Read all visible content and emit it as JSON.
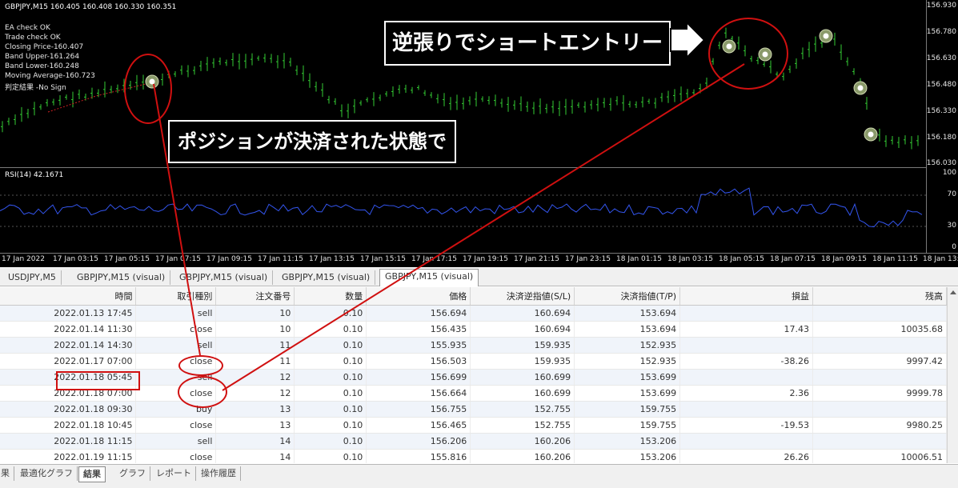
{
  "chart": {
    "header": "GBPJPY,M15  160.405 160.408 160.330 160.351",
    "info_lines": [
      "EA check OK",
      "Trade check OK",
      "Closing Price-160.407",
      "Band Upper-161.264",
      "Band Lower-160.248",
      "Moving Average-160.723",
      "判定結果 -No Sign"
    ],
    "price_labels": [
      "156.930",
      "156.780",
      "156.630",
      "156.480",
      "156.330",
      "156.180",
      "156.030"
    ],
    "rsi_label": "RSI(14) 42.1671",
    "rsi_levels": [
      "100",
      "70",
      "30",
      "0"
    ],
    "time_labels": [
      "17 Jan 2022",
      "17 Jan 03:15",
      "17 Jan 05:15",
      "17 Jan 07:15",
      "17 Jan 09:15",
      "17 Jan 11:15",
      "17 Jan 13:15",
      "17 Jan 15:15",
      "17 Jan 17:15",
      "17 Jan 19:15",
      "17 Jan 21:15",
      "17 Jan 23:15",
      "18 Jan 01:15",
      "18 Jan 03:15",
      "18 Jan 05:15",
      "18 Jan 07:15",
      "18 Jan 09:15",
      "18 Jan 11:15",
      "18 Jan 13:"
    ],
    "candle_color": "#33cc33",
    "rsi_color": "#3355ee"
  },
  "callouts": {
    "entry": "逆張りでショートエントリー",
    "closed": "ポジションが決済された状態で"
  },
  "tabs": [
    "USDJPY,M5",
    "GBPJPY,M15 (visual)",
    "GBPJPY,M15 (visual)",
    "GBPJPY,M15 (visual)",
    "GBPJPY,M15 (visual)"
  ],
  "active_tab_index": 4,
  "table": {
    "headers": [
      "時間",
      "取引種別",
      "注文番号",
      "数量",
      "価格",
      "決済逆指値(S/L)",
      "決済指値(T/P)",
      "損益",
      "残高"
    ],
    "rows": [
      [
        "2022.01.13 17:45",
        "sell",
        "10",
        "0.10",
        "156.694",
        "160.694",
        "153.694",
        "",
        ""
      ],
      [
        "2022.01.14 11:30",
        "close",
        "10",
        "0.10",
        "156.435",
        "160.694",
        "153.694",
        "17.43",
        "10035.68"
      ],
      [
        "2022.01.14 14:30",
        "sell",
        "11",
        "0.10",
        "155.935",
        "159.935",
        "152.935",
        "",
        ""
      ],
      [
        "2022.01.17 07:00",
        "close",
        "11",
        "0.10",
        "156.503",
        "159.935",
        "152.935",
        "-38.26",
        "9997.42"
      ],
      [
        "2022.01.18 05:45",
        "sell",
        "12",
        "0.10",
        "156.699",
        "160.699",
        "153.699",
        "",
        ""
      ],
      [
        "2022.01.18 07:00",
        "close",
        "12",
        "0.10",
        "156.664",
        "160.699",
        "153.699",
        "2.36",
        "9999.78"
      ],
      [
        "2022.01.18 09:30",
        "buy",
        "13",
        "0.10",
        "156.755",
        "152.755",
        "159.755",
        "",
        ""
      ],
      [
        "2022.01.18 10:45",
        "close",
        "13",
        "0.10",
        "156.465",
        "152.755",
        "159.755",
        "-19.53",
        "9980.25"
      ],
      [
        "2022.01.18 11:15",
        "sell",
        "14",
        "0.10",
        "156.206",
        "160.206",
        "153.206",
        "",
        ""
      ],
      [
        "2022.01.19 11:15",
        "close",
        "14",
        "0.10",
        "155.816",
        "160.206",
        "153.206",
        "26.26",
        "10006.51"
      ]
    ]
  },
  "bottom_tabs": [
    "果",
    "最適化グラフ",
    "結果",
    "グラフ",
    "レポート",
    "操作履歴"
  ],
  "active_bottom_tab_index": 2,
  "highlight_color": "#d01010"
}
